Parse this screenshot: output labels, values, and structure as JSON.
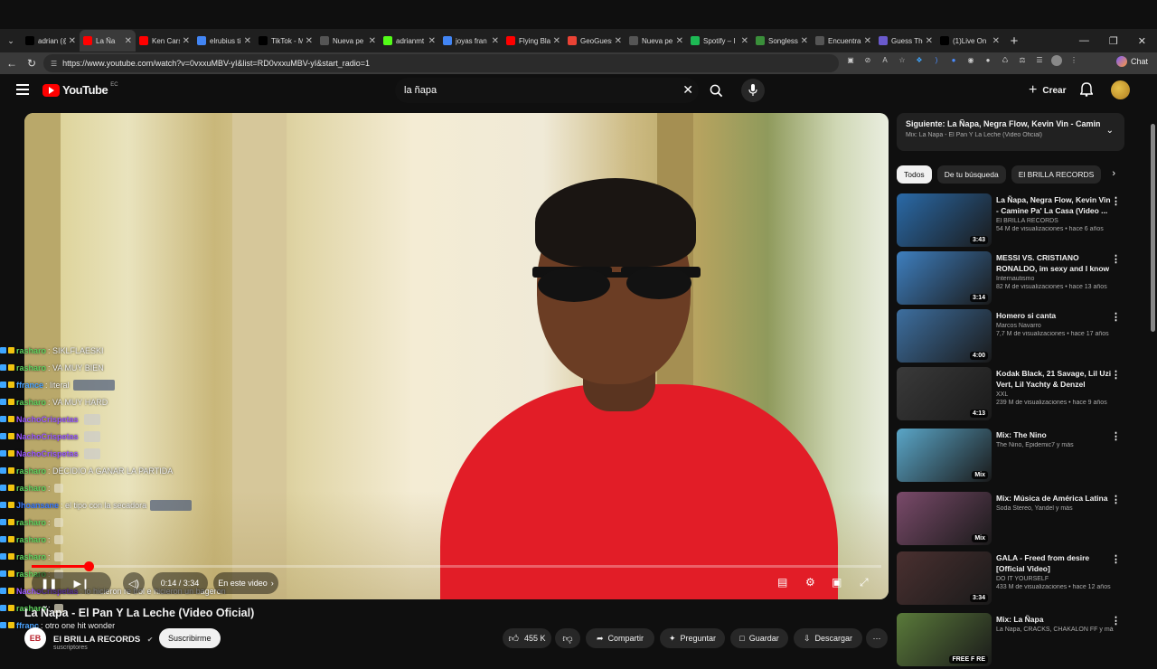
{
  "browser": {
    "tabs": [
      {
        "title": "adrian (@",
        "color": "#000000",
        "icon": "x-logo-icon"
      },
      {
        "title": "La Ña",
        "color": "#ff0000",
        "icon": "youtube-icon",
        "active": true
      },
      {
        "title": "Ken Carso",
        "color": "#ff0000",
        "icon": "youtube-icon"
      },
      {
        "title": "elrubius ti",
        "color": "#4285f4",
        "icon": "google-icon"
      },
      {
        "title": "TikTok - M",
        "color": "#000000",
        "icon": "tiktok-icon"
      },
      {
        "title": "Nueva pe",
        "color": "#555555",
        "icon": "page-icon"
      },
      {
        "title": "adrianmt",
        "color": "#53fc18",
        "icon": "kick-icon"
      },
      {
        "title": "joyas fran",
        "color": "#4285f4",
        "icon": "google-icon"
      },
      {
        "title": "Flying Bla",
        "color": "#ff0000",
        "icon": "youtube-icon"
      },
      {
        "title": "GeoGuess",
        "color": "#ea4335",
        "icon": "map-pin-icon"
      },
      {
        "title": "Nueva pe",
        "color": "#555555",
        "icon": "page-icon"
      },
      {
        "title": "Spotify – I",
        "color": "#1db954",
        "icon": "spotify-icon"
      },
      {
        "title": "Songless",
        "color": "#3a8f3a",
        "icon": "songless-icon"
      },
      {
        "title": "Encuentra",
        "color": "#555555",
        "icon": "page-icon"
      },
      {
        "title": "Guess The",
        "color": "#6a5acd",
        "icon": "game-icon"
      },
      {
        "title": "(1)Live On",
        "color": "#000000",
        "icon": "tiktok-icon"
      }
    ],
    "url": "https://www.youtube.com/watch?v=0vxxuMBV-yI&list=RD0vxxuMBV-yI&start_radio=1",
    "chat_button": "Chat"
  },
  "youtube": {
    "logo_text": "YouTube",
    "country": "EC",
    "search_value": "la ñapa",
    "create_label": "Crear"
  },
  "player": {
    "time": "0:14 / 3:34",
    "chapter_label": "En este video",
    "progress_fraction": 0.067
  },
  "chat": [
    {
      "user": "rasharo",
      "msg": ": SIKLFLAESKI",
      "color": "#5fd35f"
    },
    {
      "user": "rasharo",
      "msg": ": VA MUY BIEN",
      "color": "#5fd35f"
    },
    {
      "user": "ffrance",
      "msg": ": literal",
      "color": "#4aa3ff",
      "emote": "wide"
    },
    {
      "user": "rasharo",
      "msg": ": VA MUY HARD",
      "color": "#5fd35f"
    },
    {
      "user": "NachoCrispetas",
      "msg": "",
      "color": "#9b59ff",
      "emote": "norm"
    },
    {
      "user": "NachoCrispetas",
      "msg": "",
      "color": "#9b59ff",
      "emote": "norm"
    },
    {
      "user": "NachoCrispetas",
      "msg": "",
      "color": "#9b59ff",
      "emote": "norm"
    },
    {
      "user": "rasharo",
      "msg": ": DECIDIO A GANAR LA PARTIDA",
      "color": "#5fd35f"
    },
    {
      "user": "rasharo",
      "msg": ":",
      "color": "#5fd35f",
      "emote": "sm"
    },
    {
      "user": "Jhoansane",
      "msg": ": el tipo con la secadora",
      "color": "#3b7bff",
      "emote": "wide"
    },
    {
      "user": "rasharo",
      "msg": ":",
      "color": "#5fd35f",
      "emote": "sm"
    },
    {
      "user": "rasharo",
      "msg": ":",
      "color": "#5fd35f",
      "emote": "sm"
    },
    {
      "user": "rasharo",
      "msg": ":",
      "color": "#5fd35f",
      "emote": "sm"
    },
    {
      "user": "rasharo",
      "msg": ":",
      "color": "#5fd35f",
      "emote": "sm"
    },
    {
      "user": "NachoCrispetas",
      "msg": ": lo hicieron re trol e hicieron un bageron",
      "color": "#9b59ff"
    },
    {
      "user": "rasharo",
      "msg": ":",
      "color": "#5fd35f",
      "emote": "sm"
    },
    {
      "user": "ffranc",
      "msg": ": otro one hit wonder",
      "color": "#4aa3ff"
    }
  ],
  "sidebar": {
    "playlist_title": "Siguiente: La Ñapa, Negra Flow, Kevin Vin - Camine ...",
    "playlist_sub": "Mix: La Ñapa - El Pan Y La Leche (Video Oficial)",
    "chips": [
      "Todos",
      "De tu búsqueda",
      "El BRILLA RECORDS"
    ],
    "videos": [
      {
        "title": "La Ñapa, Negra Flow, Kevin Vin - Camine Pa' La Casa (Video ...",
        "channel": "El BRILLA RECORDS",
        "meta": "54 M de visualizaciones • hace 6 años",
        "duration": "3:43",
        "thumb_color": "#2a6aa8",
        "verified": true
      },
      {
        "title": "MESSI VS. CRISTIANO RONALDO, im sexy and I know ...",
        "channel": "Internautismo",
        "meta": "82 M de visualizaciones • hace 13 años",
        "duration": "3:14",
        "thumb_color": "#3e7fbf",
        "verified": true
      },
      {
        "title": "Homero si canta",
        "channel": "Marcos Navarro",
        "meta": "7,7 M de visualizaciones • hace 17 años",
        "duration": "4:00",
        "thumb_color": "#3d6fa0",
        "verified": false
      },
      {
        "title": "Kodak Black, 21 Savage, Lil Uzi Vert, Lil Yachty & Denzel Curry...",
        "channel": "XXL",
        "meta": "239 M de visualizaciones • hace 9 años",
        "duration": "4:13",
        "thumb_color": "#3a3a3a",
        "verified": true
      },
      {
        "title": "Mix: The Nino",
        "channel": "The Nino, Epidemic7 y más",
        "meta": "",
        "duration": "Mix",
        "thumb_color": "#5aa6c8",
        "verified": false
      },
      {
        "title": "Mix: Música de América Latina",
        "channel": "Soda Stereo, Yandel y más",
        "meta": "",
        "duration": "Mix",
        "thumb_color": "#7a4a6a",
        "verified": false
      },
      {
        "title": "GALA - Freed from desire [Official Video]",
        "channel": "DO IT YOURSELF",
        "meta": "433 M de visualizaciones • hace 12 años",
        "duration": "3:34",
        "thumb_color": "#4a3030",
        "verified": true
      },
      {
        "title": "Mix: La Ñapa",
        "channel": "La Ñapa, CRACKS, CHAKALON FF y más",
        "meta": "",
        "duration": "FREE F RE",
        "thumb_color": "#5a7a3a",
        "verified": false
      }
    ]
  },
  "video": {
    "title": "La Ñapa - El Pan Y La Leche (Video Oficial)",
    "channel": "El BRILLA RECORDS",
    "subs": "suscriptores",
    "subscribe_label": "Suscribirme",
    "likes": "455 K",
    "share_label": "Compartir",
    "ask_label": "Preguntar",
    "save_label": "Guardar",
    "download_label": "Descargar"
  }
}
